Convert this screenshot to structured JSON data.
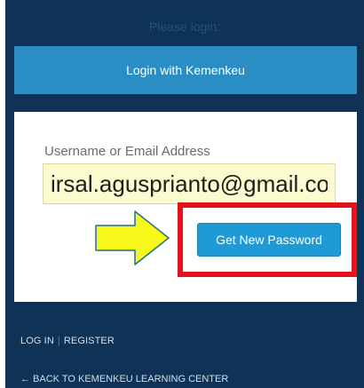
{
  "login_prompt": "Please login:",
  "sso_button_label": "Login with Kemenkeu",
  "form": {
    "username_label": "Username or Email Address",
    "username_value": "irsal.agusprianto@gmail.com",
    "submit_label": "Get New Password"
  },
  "annotations": {
    "arrow_color": "#f7f71a",
    "highlight_color": "#e3131b"
  },
  "footer": {
    "login_link": "LOG IN",
    "separator": "|",
    "register_link": "REGISTER",
    "back_link": "← BACK TO KEMENKEU LEARNING CENTER"
  },
  "colors": {
    "panel_bg": "#0f3356",
    "sso_button_bg": "#2a8dc4",
    "primary_button_bg": "#1e9ad6",
    "input_bg": "#fbfbcf"
  }
}
